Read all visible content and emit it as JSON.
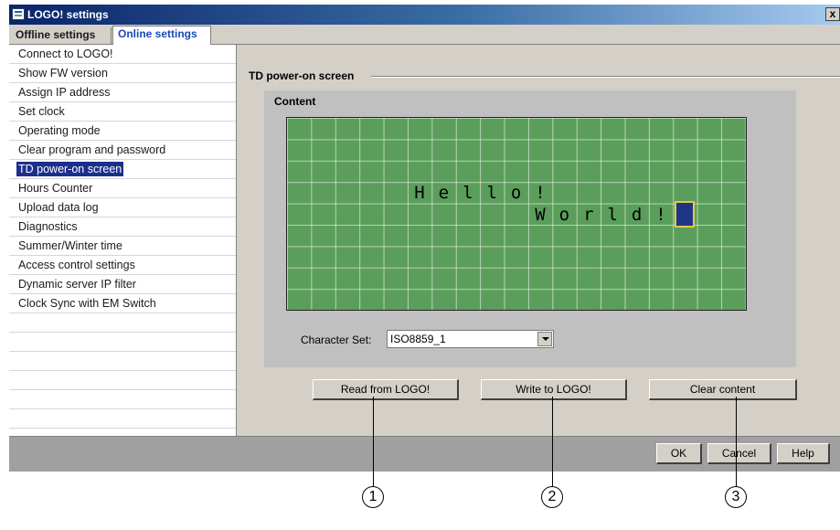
{
  "window": {
    "title": "LOGO! settings",
    "close_symbol": "x"
  },
  "tabs": [
    {
      "label": "Offline settings",
      "active": false
    },
    {
      "label": "Online settings",
      "active": true
    }
  ],
  "sidebar": {
    "items": [
      {
        "label": "Connect to LOGO!"
      },
      {
        "label": "Show FW version"
      },
      {
        "label": "Assign IP address"
      },
      {
        "label": "Set clock"
      },
      {
        "label": "Operating mode"
      },
      {
        "label": "Clear program and password"
      },
      {
        "label": "TD power-on screen",
        "selected": true
      },
      {
        "label": "Hours Counter"
      },
      {
        "label": "Upload data log"
      },
      {
        "label": "Diagnostics"
      },
      {
        "label": "Summer/Winter time"
      },
      {
        "label": "Access control settings"
      },
      {
        "label": "Dynamic server IP filter"
      },
      {
        "label": "Clock Sync with EM Switch"
      }
    ]
  },
  "main": {
    "section_title": "TD power-on screen",
    "content_title": "Content",
    "display": {
      "lines": [
        "Hello!",
        "World!"
      ]
    },
    "charset_label": "Character Set:",
    "charset_value": "ISO8859_1",
    "buttons": {
      "read": "Read from LOGO!",
      "write": "Write to LOGO!",
      "clear": "Clear content"
    }
  },
  "footer": {
    "ok": "OK",
    "cancel": "Cancel",
    "help": "Help"
  },
  "callouts": [
    "1",
    "2",
    "3"
  ],
  "colors": {
    "lcd_background": "#5b9e5b",
    "selection": "#1c2f8c",
    "active_tab_text": "#1a49b8",
    "cursor_fill": "#1f3687",
    "cursor_border": "#e7c64a"
  }
}
